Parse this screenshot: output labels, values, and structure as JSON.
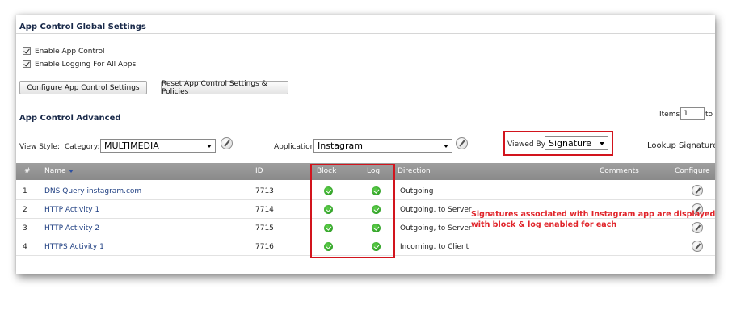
{
  "global_settings": {
    "title": "App Control Global Settings",
    "enable_app_control_label": "Enable App Control",
    "enable_logging_label": "Enable Logging For All Apps",
    "configure_button": "Configure App Control Settings",
    "reset_button": "Reset App Control Settings & Policies"
  },
  "advanced": {
    "title": "App Control Advanced",
    "items_label": "Items",
    "items_value": "1",
    "items_to": "to",
    "view_style_label": "View Style:",
    "category_label": "Category:",
    "category_value": "MULTIMEDIA",
    "application_label": "Application:",
    "application_value": "Instagram",
    "viewed_by_label": "Viewed By:",
    "viewed_by_value": "Signature",
    "lookup_label": "Lookup Signature"
  },
  "table": {
    "headers": {
      "num": "#",
      "name": "Name",
      "id": "ID",
      "block": "Block",
      "log": "Log",
      "direction": "Direction",
      "comments": "Comments",
      "configure": "Configure"
    },
    "rows": [
      {
        "num": "1",
        "name": "DNS Query instagram.com",
        "id": "7713",
        "direction": "Outgoing"
      },
      {
        "num": "2",
        "name": "HTTP Activity 1",
        "id": "7714",
        "direction": "Outgoing, to Server"
      },
      {
        "num": "3",
        "name": "HTTP Activity 2",
        "id": "7715",
        "direction": "Outgoing, to Server"
      },
      {
        "num": "4",
        "name": "HTTPS Activity 1",
        "id": "7716",
        "direction": "Incoming, to Client"
      }
    ]
  },
  "annotation": {
    "line1": "Signatures associated with Instagram app are displayed",
    "line2": "with block & log enabled for each"
  },
  "colors": {
    "annotation_red": "#d2141d",
    "header_gray": "#8a8a8a",
    "check_green": "#1f8f1a"
  }
}
